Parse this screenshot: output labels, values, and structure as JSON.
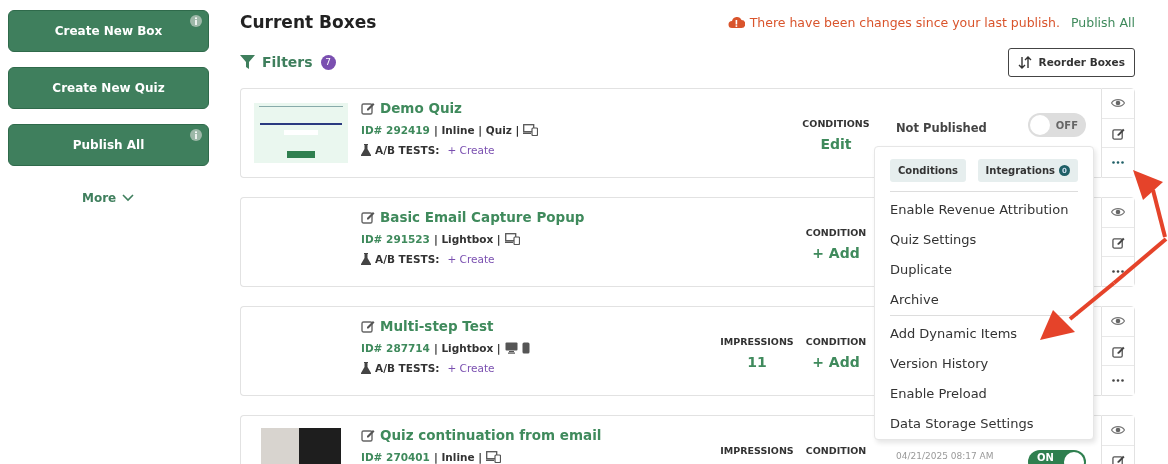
{
  "sidebar": {
    "buttons": [
      {
        "label": "Create New Box",
        "info": true
      },
      {
        "label": "Create New Quiz",
        "info": false
      },
      {
        "label": "Publish All",
        "info": true
      }
    ],
    "more": "More"
  },
  "header": {
    "title": "Current Boxes",
    "alert": "There have been changes since your last publish.",
    "alert_action": "Publish All",
    "filters": "Filters",
    "filters_count": "7",
    "reorder": "Reorder Boxes"
  },
  "cards": [
    {
      "thumbnail": {
        "kind": "quiz"
      },
      "name": "Demo Quiz",
      "id": "ID# 292419",
      "meta": "| Inline | Quiz |",
      "devices": {
        "kind": "combined"
      },
      "ab_label": "A/B TESTS:",
      "ab_action": "+ Create",
      "conditions_label": "CONDITIONS",
      "conditions_value": "Edit",
      "status": "Not Published",
      "toggle": {
        "on": false,
        "label": "OFF"
      }
    },
    {
      "name": "Basic Email Capture Popup",
      "id": "ID# 291523",
      "meta": "| Lightbox |",
      "devices": {
        "kind": "combined"
      },
      "ab_label": "A/B TESTS:",
      "ab_action": "+ Create",
      "conditions_label": "CONDITION",
      "conditions_value": "+ Add"
    },
    {
      "name": "Multi-step Test",
      "id": "ID# 287714",
      "meta": "| Lightbox |",
      "devices": {
        "kind": "separate"
      },
      "ab_label": "A/B TESTS:",
      "ab_action": "+ Create",
      "impressions_label": "IMPRESSIONS",
      "impressions_value": "11",
      "conditions_label": "CONDITION",
      "conditions_value": "+ Add"
    },
    {
      "thumbnail": {
        "kind": "photo"
      },
      "name": "Quiz continuation from email",
      "id": "ID# 270401",
      "meta": "| Inline |",
      "devices": {
        "kind": "combined"
      },
      "impressions_label": "IMPRESSIONS",
      "conditions_label": "CONDITION",
      "status": "04/21/2025 08:17 AM",
      "toggle": {
        "on": true,
        "label": "ON"
      }
    }
  ],
  "menu": {
    "chips": [
      {
        "label": "Conditions"
      },
      {
        "label": "Integrations",
        "count": "0"
      }
    ],
    "groups": [
      [
        "Enable Revenue Attribution",
        "Quiz Settings",
        "Duplicate",
        "Archive"
      ],
      [
        "Add Dynamic Items",
        "Version History",
        "Enable Preload",
        "Data Storage Settings"
      ]
    ]
  }
}
